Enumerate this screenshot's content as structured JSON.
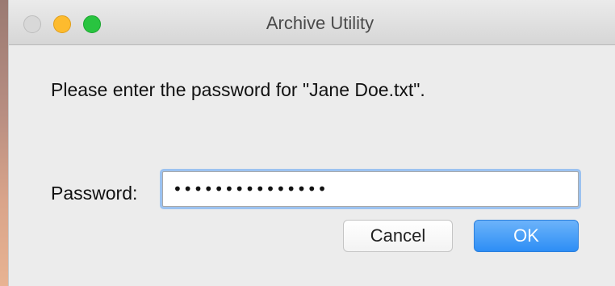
{
  "window": {
    "title": "Archive Utility"
  },
  "dialog": {
    "message": "Please enter the password for \"Jane Doe.txt\".",
    "password_label": "Password:",
    "password_value": "•••••••••••••••",
    "cancel_label": "Cancel",
    "ok_label": "OK"
  },
  "colors": {
    "ok_button": "#2d8ef5",
    "focus_ring": "#9cc2f0",
    "minimize": "#fdbb2e",
    "zoom": "#29c440"
  },
  "icons": [
    "close-button",
    "minimize-button",
    "zoom-button"
  ]
}
